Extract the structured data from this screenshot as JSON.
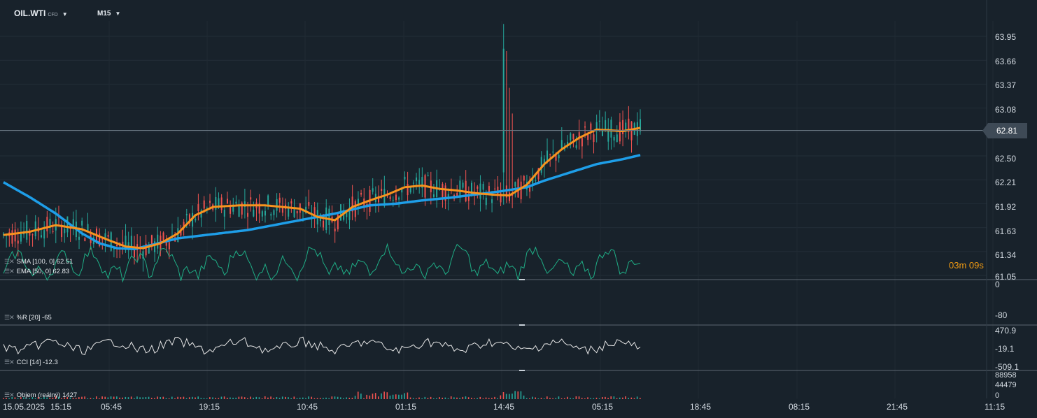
{
  "header": {
    "symbol": "OIL.WTI",
    "symbol_type": "CFD",
    "timeframe": "M15"
  },
  "price_axis": [
    "63.95",
    "63.66",
    "63.37",
    "63.08",
    "62.50",
    "62.21",
    "61.92",
    "61.63",
    "61.34",
    "61.05"
  ],
  "current_price": "62.81",
  "countdown": "03m 09s",
  "time_axis": [
    "15.05.2025",
    "15:15",
    "05:45",
    "19:15",
    "10:45",
    "01:15",
    "14:45",
    "05:15",
    "18:45",
    "08:15",
    "21:45",
    "11:15"
  ],
  "indicators": {
    "sma": {
      "label": "SMA [100, 0]",
      "value": "62.51",
      "color": "#1e9ee8"
    },
    "ema": {
      "label": "EMA [50, 0]",
      "value": "62.83",
      "color": "#f7931e"
    },
    "wr": {
      "label": "%R [20]",
      "value": "-65",
      "axis": [
        "0",
        "-80"
      ],
      "color": "#1fae86"
    },
    "cci": {
      "label": "CCI [14]",
      "value": "-12.3",
      "axis": [
        "470.9",
        "-19.1",
        "-509.1"
      ],
      "color": "#e6e6e6"
    },
    "volume": {
      "label": "Objem  (reálný)",
      "value": "1427",
      "axis": [
        "88958",
        "44479",
        "0"
      ]
    }
  },
  "colors": {
    "up": "#26a69a",
    "down": "#ef5350",
    "background": "#18222b"
  },
  "chart_data": {
    "type": "candlestick",
    "ylim": [
      61.05,
      64.25
    ],
    "ema_anchors": [
      [
        0,
        61.54
      ],
      [
        3,
        61.58
      ],
      [
        6,
        61.66
      ],
      [
        9,
        61.61
      ],
      [
        12,
        61.48
      ],
      [
        14,
        61.4
      ],
      [
        16,
        61.38
      ],
      [
        18,
        61.44
      ],
      [
        20,
        61.56
      ],
      [
        22,
        61.78
      ],
      [
        24,
        61.88
      ],
      [
        27,
        61.9
      ],
      [
        30,
        61.9
      ],
      [
        34,
        61.86
      ],
      [
        36,
        61.76
      ],
      [
        38,
        61.72
      ],
      [
        40,
        61.88
      ],
      [
        42,
        61.96
      ],
      [
        44,
        62.03
      ],
      [
        46,
        62.12
      ],
      [
        48,
        62.14
      ],
      [
        50,
        62.1
      ],
      [
        52,
        62.08
      ],
      [
        54,
        62.05
      ],
      [
        56,
        62.03
      ],
      [
        58,
        62.02
      ],
      [
        60,
        62.15
      ],
      [
        62,
        62.4
      ],
      [
        64,
        62.58
      ],
      [
        66,
        62.72
      ],
      [
        68,
        62.82
      ],
      [
        71,
        62.8
      ],
      [
        73,
        62.84
      ]
    ],
    "sma_anchors": [
      [
        0,
        62.18
      ],
      [
        3,
        62.0
      ],
      [
        6,
        61.8
      ],
      [
        9,
        61.56
      ],
      [
        11,
        61.44
      ],
      [
        13,
        61.38
      ],
      [
        15,
        61.37
      ],
      [
        17,
        61.42
      ],
      [
        20,
        61.5
      ],
      [
        24,
        61.55
      ],
      [
        28,
        61.6
      ],
      [
        32,
        61.68
      ],
      [
        35,
        61.74
      ],
      [
        38,
        61.8
      ],
      [
        40,
        61.85
      ],
      [
        42,
        61.9
      ],
      [
        45,
        61.92
      ],
      [
        48,
        61.96
      ],
      [
        51,
        61.99
      ],
      [
        54,
        62.03
      ],
      [
        57,
        62.07
      ],
      [
        60,
        62.12
      ],
      [
        62,
        62.2
      ],
      [
        65,
        62.3
      ],
      [
        68,
        62.4
      ],
      [
        71,
        62.46
      ],
      [
        73,
        62.51
      ]
    ]
  }
}
